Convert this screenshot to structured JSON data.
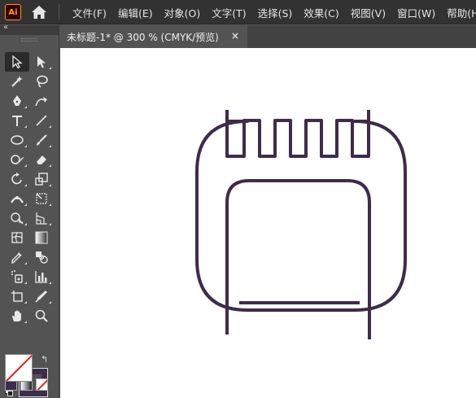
{
  "app": {
    "logo_text": "Ai"
  },
  "menu": {
    "items": [
      "文件(F)",
      "编辑(E)",
      "对象(O)",
      "文字(T)",
      "选择(S)",
      "效果(C)",
      "视图(V)",
      "窗口(W)",
      "帮助(H)"
    ]
  },
  "document": {
    "tab_title": "未标题-1* @ 300 % (CMYK/预览)",
    "close_symbol": "×"
  },
  "toolbar": {
    "collapse_symbol": "«",
    "tools": [
      "selection-tool",
      "direct-selection-tool",
      "magic-wand-tool",
      "lasso-tool",
      "pen-tool",
      "curvature-tool",
      "type-tool",
      "line-segment-tool",
      "ellipse-tool",
      "paintbrush-tool",
      "shaper-tool",
      "eraser-tool",
      "rotate-tool",
      "scale-tool",
      "width-tool",
      "free-transform-tool",
      "shape-builder-tool",
      "perspective-grid-tool",
      "mesh-tool",
      "gradient-tool",
      "eyedropper-tool",
      "blend-tool",
      "symbol-sprayer-tool",
      "column-graph-tool",
      "artboard-tool",
      "slice-tool",
      "hand-tool",
      "zoom-tool"
    ],
    "selected_tool": "selection-tool",
    "fill": "none",
    "stroke_color": "#3e2c4c",
    "swap_symbol": "↰"
  },
  "artwork": {
    "stroke_color": "#3e2c4c",
    "icon": "notebook-icon"
  }
}
